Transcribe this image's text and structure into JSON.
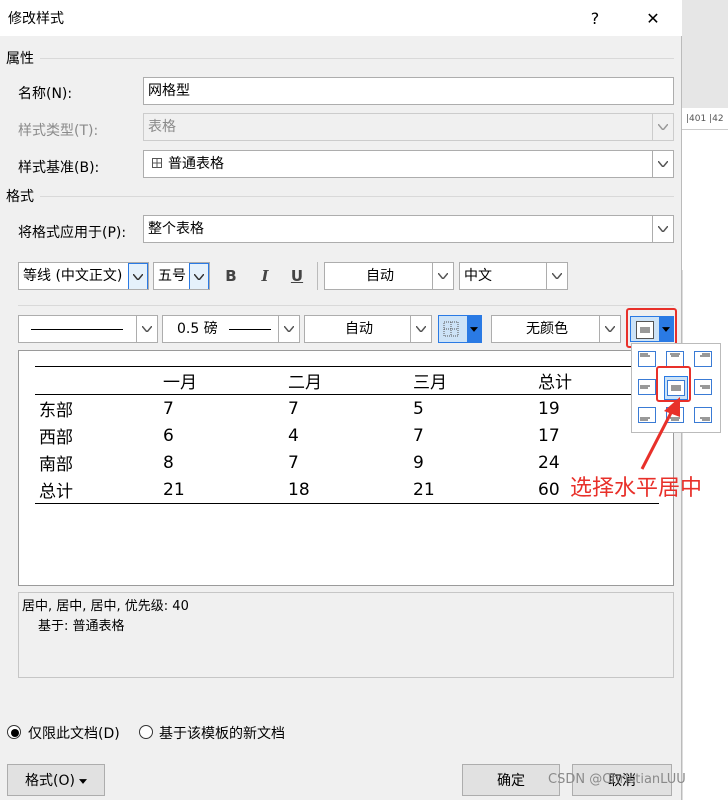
{
  "dialog": {
    "title": "修改样式",
    "help": "?",
    "close": "✕"
  },
  "background": {
    "ruler_text": "|401 |42"
  },
  "properties": {
    "section": "属性",
    "name_label": "名称(N):",
    "name_value": "网格型",
    "type_label": "样式类型(T):",
    "type_value": "表格",
    "base_label": "样式基准(B):",
    "base_value": "普通表格"
  },
  "format": {
    "section": "格式",
    "apply_label": "将格式应用于(P):",
    "apply_value": "整个表格",
    "font": "等线 (中文正文)",
    "size": "五号",
    "bold": "B",
    "italic": "I",
    "underline": "U",
    "color": "自动",
    "script": "中文",
    "line_weight": "0.5 磅",
    "border_color": "自动",
    "shading": "无颜色"
  },
  "preview": {
    "headers": [
      "",
      "一月",
      "二月",
      "三月",
      "总计"
    ],
    "rows": [
      [
        "东部",
        "7",
        "7",
        "5",
        "19"
      ],
      [
        "西部",
        "6",
        "4",
        "7",
        "17"
      ],
      [
        "南部",
        "8",
        "7",
        "9",
        "24"
      ],
      [
        "总计",
        "21",
        "18",
        "21",
        "60"
      ]
    ]
  },
  "description": {
    "line1": "居中, 居中, 居中, 优先级: 40",
    "line2": "基于: 普通表格"
  },
  "options": {
    "this_doc": "仅限此文档(D)",
    "template": "基于该模板的新文档",
    "this_doc_checked": true
  },
  "buttons": {
    "format": "格式(O)",
    "ok": "确定",
    "cancel": "取消"
  },
  "annotation": {
    "text": "选择水平居中",
    "color": "#e8302a"
  },
  "watermark": "CSDN @ChristianLUU",
  "colors": {
    "accent": "#e8302a",
    "selected": "#cde3f7",
    "dropdown_blue": "#2a7ae4"
  }
}
